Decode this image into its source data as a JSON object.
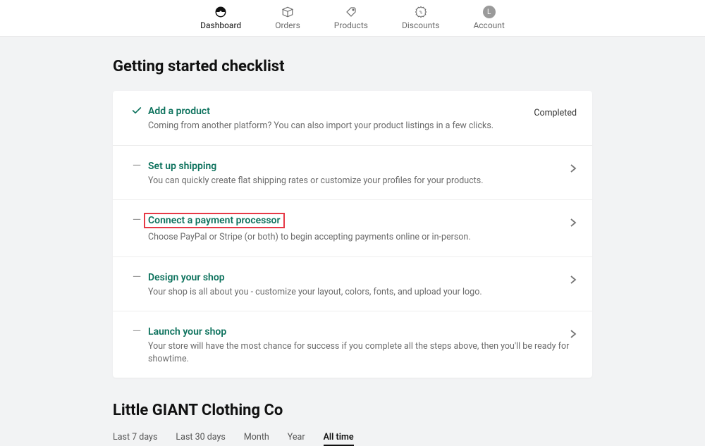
{
  "nav": {
    "items": [
      {
        "label": "Dashboard",
        "icon": "dashboard"
      },
      {
        "label": "Orders",
        "icon": "orders"
      },
      {
        "label": "Products",
        "icon": "products"
      },
      {
        "label": "Discounts",
        "icon": "discounts"
      },
      {
        "label": "Account",
        "icon": "account",
        "initial": "L"
      }
    ],
    "active_index": 0
  },
  "page": {
    "title": "Getting started checklist"
  },
  "checklist": [
    {
      "status": "done",
      "title": "Add a product",
      "desc": "Coming from another platform? You can also import your product listings in a few clicks.",
      "right": "Completed"
    },
    {
      "status": "todo",
      "title": "Set up shipping",
      "desc": "You can quickly create flat shipping rates or customize your profiles for your products.",
      "right": "chevron"
    },
    {
      "status": "todo",
      "title": "Connect a payment processor",
      "desc": "Choose PayPal or Stripe (or both) to begin accepting payments online or in-person.",
      "right": "chevron",
      "highlighted": true
    },
    {
      "status": "todo",
      "title": "Design your shop",
      "desc": "Your shop is all about you - customize your layout, colors, fonts, and upload your logo.",
      "right": "chevron"
    },
    {
      "status": "todo",
      "title": "Launch your shop",
      "desc": "Your store will have the most chance for success if you complete all the steps above, then you'll be ready for showtime.",
      "right": "chevron"
    }
  ],
  "store": {
    "name": "Little GIANT Clothing Co"
  },
  "date_ranges": {
    "options": [
      "Last 7 days",
      "Last 30 days",
      "Month",
      "Year",
      "All time"
    ],
    "active_index": 4
  }
}
